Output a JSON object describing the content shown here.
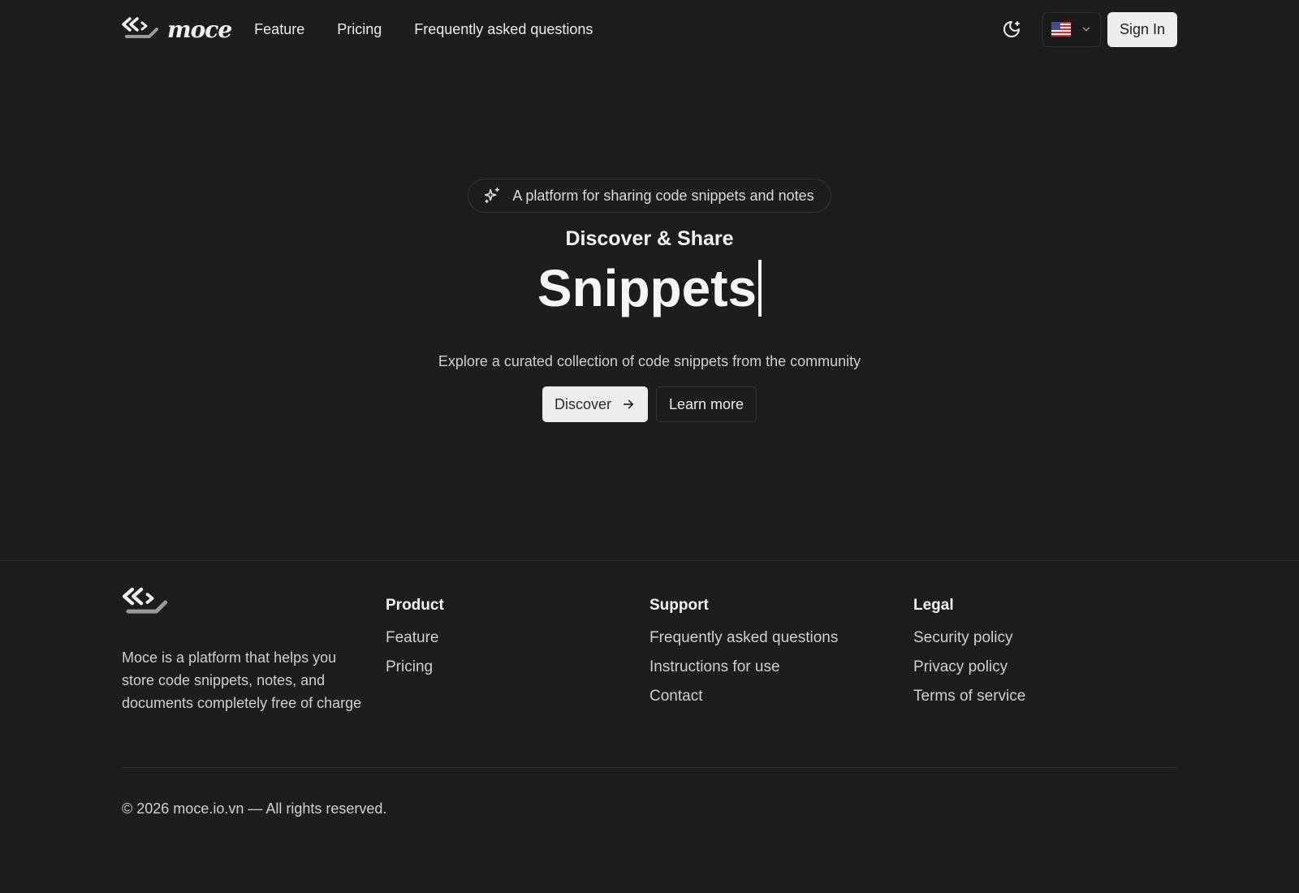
{
  "header": {
    "brand": "moce",
    "nav": [
      {
        "label": "Feature"
      },
      {
        "label": "Pricing"
      },
      {
        "label": "Frequently asked questions"
      }
    ],
    "sign_in_label": "Sign In"
  },
  "hero": {
    "badge": "A platform for sharing code snippets and notes",
    "subtitle": "Discover & Share",
    "title": "Snippets",
    "description": "Explore a curated collection of code snippets from the community",
    "primary_button": "Discover",
    "secondary_button": "Learn more"
  },
  "footer": {
    "about": "Moce is a platform that helps you store code snippets, notes, and documents completely free of charge",
    "columns": [
      {
        "title": "Product",
        "links": [
          "Feature",
          "Pricing"
        ]
      },
      {
        "title": "Support",
        "links": [
          "Frequently asked questions",
          "Instructions for use",
          "Contact"
        ]
      },
      {
        "title": "Legal",
        "links": [
          "Security policy",
          "Privacy policy",
          "Terms of service"
        ]
      }
    ],
    "copyright": "© 2026 moce.io.vn — All rights reserved."
  },
  "icons": {
    "logo": "moce-logo-icon",
    "theme": "moon-sun-icon",
    "language": "us-flag-icon",
    "dropdown": "chevron-down-icon",
    "sparkle": "sparkles-icon",
    "arrow": "arrow-right-icon"
  },
  "colors": {
    "background": "#1d1d1d",
    "text": "#ececec",
    "button_light": "#eeeeee"
  }
}
